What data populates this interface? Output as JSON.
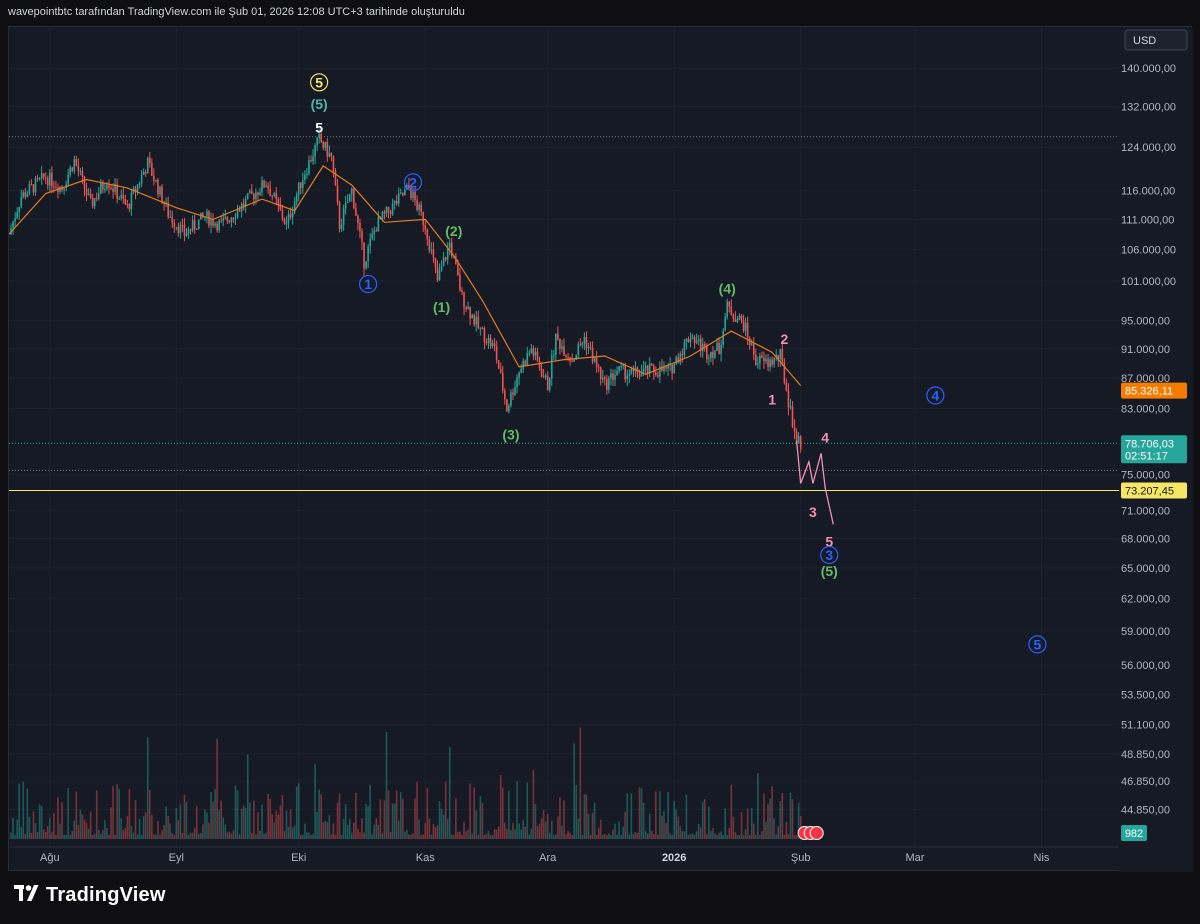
{
  "header": {
    "caption": "wavepointbtc tarafından TradingView.com ile Şub 01, 2026 12:08 UTC+3 tarihinde oluşturuldu"
  },
  "footer": {
    "brand": "TradingView",
    "logo_icon": "tradingview-logo-icon"
  },
  "colors": {
    "background": "#161a25",
    "up": "#26a69a",
    "down": "#ef5350",
    "ma": "#e17b22",
    "text": "#b2b5be",
    "yellow": "#f5e663",
    "blue_wave": "#2962ff",
    "green_wave": "#66bb6a",
    "pink_wave": "#f48fb1",
    "teal_wave": "#4db6ac",
    "orange_badge": "#f57c00",
    "green_badge": "#26a69a"
  },
  "chart_data": {
    "type": "candlestick",
    "currency_label": "USD",
    "scale": "log",
    "ylim": [
      43000,
      148000
    ],
    "y_ticks": [
      "140.000,00",
      "132.000,00",
      "124.000,00",
      "116.000,00",
      "111.000,00",
      "106.000,00",
      "101.000,00",
      "95.000,00",
      "91.000,00",
      "87.000,00",
      "83.000,00",
      "75.000,00",
      "71.000,00",
      "68.000,00",
      "65.000,00",
      "62.000,00",
      "59.000,00",
      "56.000,00",
      "53.500,00",
      "51.100,00",
      "48.850,00",
      "46.850,00",
      "44.850,00"
    ],
    "x_range": [
      "2025-07-22",
      "2026-04-20"
    ],
    "x_ticks": [
      {
        "date": "2025-08-01",
        "label": "Ağu",
        "bold": false
      },
      {
        "date": "2025-09-01",
        "label": "Eyl",
        "bold": false
      },
      {
        "date": "2025-10-01",
        "label": "Eki",
        "bold": false
      },
      {
        "date": "2025-11-01",
        "label": "Kas",
        "bold": false
      },
      {
        "date": "2025-12-01",
        "label": "Ara",
        "bold": false
      },
      {
        "date": "2026-01-01",
        "label": "2026",
        "bold": true
      },
      {
        "date": "2026-02-01",
        "label": "Şub",
        "bold": false
      },
      {
        "date": "2026-03-01",
        "label": "Mar",
        "bold": false
      },
      {
        "date": "2026-04-01",
        "label": "Nis",
        "bold": false
      }
    ],
    "price_anchors": [
      {
        "date": "2025-07-22",
        "price": 108500
      },
      {
        "date": "2025-07-25",
        "price": 115000
      },
      {
        "date": "2025-07-31",
        "price": 118500
      },
      {
        "date": "2025-08-04",
        "price": 116500
      },
      {
        "date": "2025-08-07",
        "price": 121500
      },
      {
        "date": "2025-08-11",
        "price": 113500
      },
      {
        "date": "2025-08-15",
        "price": 118000
      },
      {
        "date": "2025-08-20",
        "price": 113000
      },
      {
        "date": "2025-08-25",
        "price": 121000
      },
      {
        "date": "2025-08-30",
        "price": 112000
      },
      {
        "date": "2025-09-03",
        "price": 108500
      },
      {
        "date": "2025-09-08",
        "price": 111500
      },
      {
        "date": "2025-09-12",
        "price": 110000
      },
      {
        "date": "2025-09-18",
        "price": 114000
      },
      {
        "date": "2025-09-23",
        "price": 117500
      },
      {
        "date": "2025-09-28",
        "price": 110000
      },
      {
        "date": "2025-10-02",
        "price": 118500
      },
      {
        "date": "2025-10-06",
        "price": 125500
      },
      {
        "date": "2025-10-09",
        "price": 122000
      },
      {
        "date": "2025-10-11",
        "price": 110000
      },
      {
        "date": "2025-10-14",
        "price": 116000
      },
      {
        "date": "2025-10-17",
        "price": 104000
      },
      {
        "date": "2025-10-20",
        "price": 110000
      },
      {
        "date": "2025-10-25",
        "price": 114000
      },
      {
        "date": "2025-10-28",
        "price": 116500
      },
      {
        "date": "2025-11-01",
        "price": 110000
      },
      {
        "date": "2025-11-04",
        "price": 101000
      },
      {
        "date": "2025-11-07",
        "price": 107000
      },
      {
        "date": "2025-11-10",
        "price": 98500
      },
      {
        "date": "2025-11-14",
        "price": 94000
      },
      {
        "date": "2025-11-18",
        "price": 91000
      },
      {
        "date": "2025-11-21",
        "price": 83000
      },
      {
        "date": "2025-11-24",
        "price": 88000
      },
      {
        "date": "2025-11-27",
        "price": 91000
      },
      {
        "date": "2025-12-01",
        "price": 86000
      },
      {
        "date": "2025-12-03",
        "price": 92500
      },
      {
        "date": "2025-12-07",
        "price": 89500
      },
      {
        "date": "2025-12-10",
        "price": 92500
      },
      {
        "date": "2025-12-15",
        "price": 86000
      },
      {
        "date": "2025-12-18",
        "price": 88000
      },
      {
        "date": "2025-12-22",
        "price": 87500
      },
      {
        "date": "2025-12-26",
        "price": 88000
      },
      {
        "date": "2025-12-31",
        "price": 88000
      },
      {
        "date": "2026-01-05",
        "price": 93000
      },
      {
        "date": "2026-01-09",
        "price": 90500
      },
      {
        "date": "2026-01-12",
        "price": 91000
      },
      {
        "date": "2026-01-14",
        "price": 97000
      },
      {
        "date": "2026-01-18",
        "price": 94500
      },
      {
        "date": "2026-01-21",
        "price": 89500
      },
      {
        "date": "2026-01-24",
        "price": 89000
      },
      {
        "date": "2026-01-27",
        "price": 90000
      },
      {
        "date": "2026-01-29",
        "price": 84000
      },
      {
        "date": "2026-01-31",
        "price": 79000
      },
      {
        "date": "2026-02-01",
        "price": 78700
      }
    ],
    "ma_anchors": [
      {
        "date": "2025-07-22",
        "price": 108500
      },
      {
        "date": "2025-07-31",
        "price": 115500
      },
      {
        "date": "2025-08-10",
        "price": 118000
      },
      {
        "date": "2025-08-20",
        "price": 116500
      },
      {
        "date": "2025-09-01",
        "price": 113000
      },
      {
        "date": "2025-09-10",
        "price": 111000
      },
      {
        "date": "2025-09-22",
        "price": 114500
      },
      {
        "date": "2025-09-30",
        "price": 112500
      },
      {
        "date": "2025-10-07",
        "price": 120500
      },
      {
        "date": "2025-10-14",
        "price": 117000
      },
      {
        "date": "2025-10-22",
        "price": 110500
      },
      {
        "date": "2025-11-01",
        "price": 111000
      },
      {
        "date": "2025-11-08",
        "price": 105000
      },
      {
        "date": "2025-11-15",
        "price": 98000
      },
      {
        "date": "2025-11-24",
        "price": 88500
      },
      {
        "date": "2025-12-05",
        "price": 89500
      },
      {
        "date": "2025-12-15",
        "price": 90000
      },
      {
        "date": "2025-12-25",
        "price": 87500
      },
      {
        "date": "2026-01-05",
        "price": 90000
      },
      {
        "date": "2026-01-15",
        "price": 93500
      },
      {
        "date": "2026-01-25",
        "price": 90500
      },
      {
        "date": "2026-02-01",
        "price": 86000
      }
    ],
    "projections": [
      {
        "name": "pink-projection",
        "color": "#f48fb1",
        "points": [
          {
            "date": "2026-01-31",
            "price": 79000
          },
          {
            "date": "2026-02-01",
            "price": 74000
          },
          {
            "date": "2026-02-03",
            "price": 76500
          },
          {
            "date": "2026-02-04",
            "price": 74000
          },
          {
            "date": "2026-02-06",
            "price": 77500
          },
          {
            "date": "2026-02-07",
            "price": 73500
          },
          {
            "date": "2026-02-09",
            "price": 69500
          }
        ]
      }
    ],
    "horizontal_lines": [
      {
        "price": 126000,
        "style": "dotted",
        "color": "#787b86"
      },
      {
        "price": 78706,
        "style": "dotted",
        "color": "#26a69a"
      },
      {
        "price": 75500,
        "style": "dotted",
        "color": "#787b86"
      },
      {
        "price": 73207.45,
        "style": "solid",
        "color": "#f5e663"
      }
    ],
    "wave_labels": [
      {
        "text": "5",
        "date": "2025-10-06",
        "price": 137000,
        "color": "#f5e663",
        "circle": true
      },
      {
        "text": "(5)",
        "date": "2025-10-06",
        "price": 132500,
        "color": "#4db6ac",
        "circle": false
      },
      {
        "text": "5",
        "date": "2025-10-06",
        "price": 127800,
        "color": "#ffffff",
        "circle": false
      },
      {
        "text": "2",
        "date": "2025-10-29",
        "price": 117500,
        "color": "#2962ff",
        "circle": true
      },
      {
        "text": "1",
        "date": "2025-10-18",
        "price": 100500,
        "color": "#2962ff",
        "circle": true
      },
      {
        "text": "(2)",
        "date": "2025-11-08",
        "price": 109000,
        "color": "#66bb6a",
        "circle": false
      },
      {
        "text": "(1)",
        "date": "2025-11-05",
        "price": 97000,
        "color": "#66bb6a",
        "circle": false
      },
      {
        "text": "(3)",
        "date": "2025-11-22",
        "price": 79800,
        "color": "#66bb6a",
        "circle": false
      },
      {
        "text": "(4)",
        "date": "2026-01-14",
        "price": 99800,
        "color": "#66bb6a",
        "circle": false
      },
      {
        "text": "2",
        "date": "2026-01-28",
        "price": 92400,
        "color": "#f48fb1",
        "circle": false
      },
      {
        "text": "1",
        "date": "2026-01-25",
        "price": 84200,
        "color": "#f48fb1",
        "circle": false
      },
      {
        "text": "4",
        "date": "2026-02-07",
        "price": 79400,
        "color": "#f48fb1",
        "circle": false
      },
      {
        "text": "3",
        "date": "2026-02-04",
        "price": 70800,
        "color": "#f48fb1",
        "circle": false
      },
      {
        "text": "5",
        "date": "2026-02-08",
        "price": 67700,
        "color": "#f48fb1",
        "circle": false
      },
      {
        "text": "3",
        "date": "2026-02-08",
        "price": 66300,
        "color": "#2962ff",
        "circle": true
      },
      {
        "text": "(5)",
        "date": "2026-02-08",
        "price": 64700,
        "color": "#66bb6a",
        "circle": false
      },
      {
        "text": "4",
        "date": "2026-03-06",
        "price": 84700,
        "color": "#2962ff",
        "circle": true
      },
      {
        "text": "5",
        "date": "2026-03-31",
        "price": 57800,
        "color": "#2962ff",
        "circle": true
      }
    ],
    "price_badges": [
      {
        "price": 85326.11,
        "text": "85.326,11",
        "sub": "",
        "bg": "#f57c00",
        "fg": "#ffffff"
      },
      {
        "price": 78706.03,
        "text": "78.706,03",
        "sub": "02:51:17",
        "bg": "#26a69a",
        "fg": "#ffffff"
      },
      {
        "price": 73207.45,
        "text": "73.207,45",
        "sub": "",
        "bg": "#f5e663",
        "fg": "#131722"
      }
    ],
    "volume_badge": {
      "text": "982",
      "bg": "#26a69a"
    }
  }
}
